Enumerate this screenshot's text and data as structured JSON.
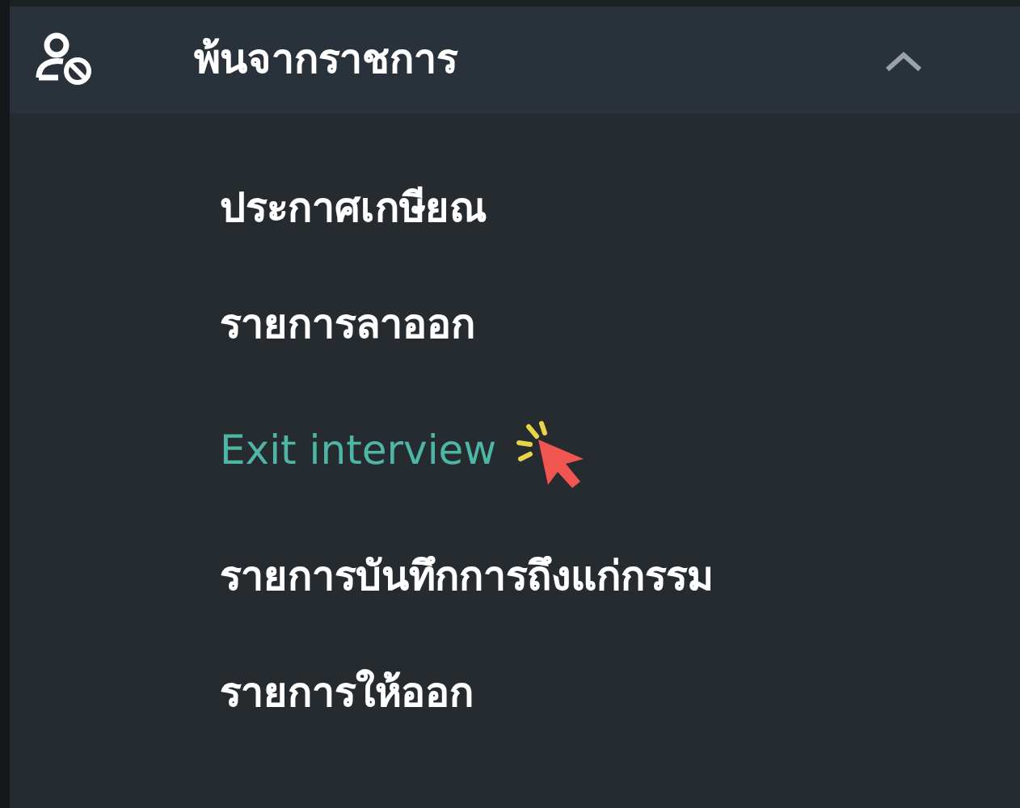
{
  "section": {
    "title": "พ้นจากราชการ",
    "expanded": true
  },
  "items": [
    {
      "label": "ประกาศเกษียณ",
      "selected": false
    },
    {
      "label": "รายการลาออก",
      "selected": false
    },
    {
      "label": "Exit interview",
      "selected": true
    },
    {
      "label": "รายการบันทึกการถึงแก่กรรม",
      "selected": false
    },
    {
      "label": "รายการให้ออก",
      "selected": false
    }
  ]
}
